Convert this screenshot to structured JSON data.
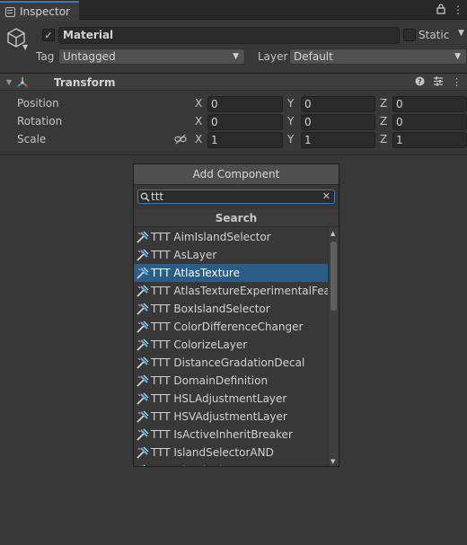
{
  "tab": {
    "title": "Inspector"
  },
  "object": {
    "name": "Material",
    "active": true,
    "static_label": "Static",
    "tag_label": "Tag",
    "tag_value": "Untagged",
    "layer_label": "Layer",
    "layer_value": "Default"
  },
  "transform": {
    "title": "Transform",
    "rows": [
      {
        "label": "Position",
        "x": "0",
        "y": "0",
        "z": "0"
      },
      {
        "label": "Rotation",
        "x": "0",
        "y": "0",
        "z": "0"
      },
      {
        "label": "Scale",
        "x": "1",
        "y": "1",
        "z": "1"
      }
    ],
    "axis_x": "X",
    "axis_y": "Y",
    "axis_z": "Z"
  },
  "add_component": {
    "title": "Add Component",
    "search_value": "ttt",
    "section_title": "Search",
    "selected_index": 2,
    "items": [
      "TTT AimIslandSelector",
      "TTT AsLayer",
      "TTT AtlasTexture",
      "TTT AtlasTextureExperimentalFeature",
      "TTT BoxIslandSelector",
      "TTT ColorDifferenceChanger",
      "TTT ColorizeLayer",
      "TTT DistanceGradationDecal",
      "TTT DomainDefinition",
      "TTT HSLAdjustmentLayer",
      "TTT HSVAdjustmentLayer",
      "TTT IsActiveInheritBreaker",
      "TTT IslandSelectorAND",
      "TTT IslandSelectorNOT"
    ]
  },
  "colors": {
    "accent": "#3a79bb",
    "selected_row": "#2c5d87",
    "background": "#383838"
  }
}
